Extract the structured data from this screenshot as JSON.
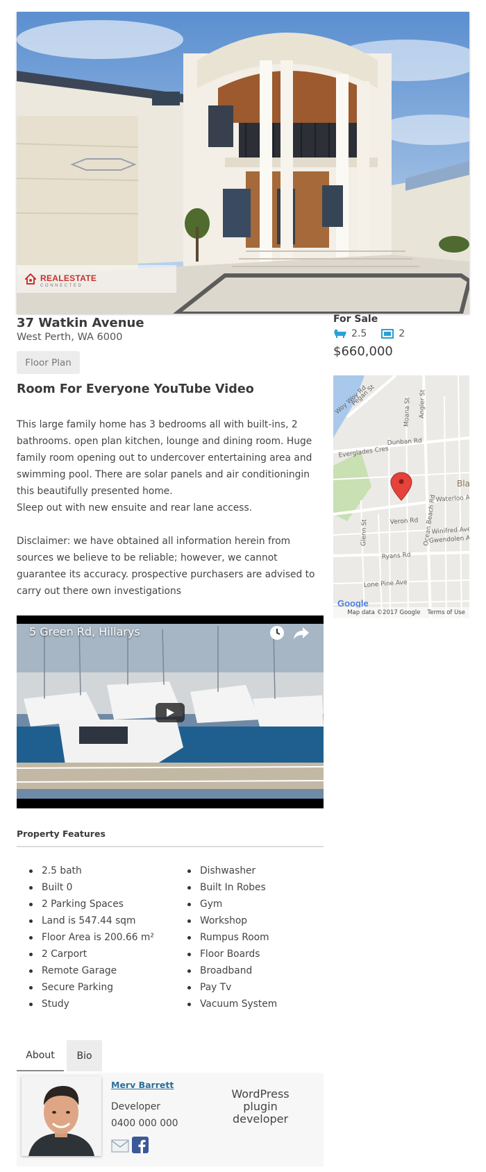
{
  "listing": {
    "title": "37 Watkin Avenue",
    "suburb": "West Perth, WA 6000",
    "status": "For Sale",
    "bathrooms": "2.5",
    "parking": "2",
    "price": "$660,000"
  },
  "logo": {
    "text": "REALESTATE",
    "sub": "CONNECTED",
    "colors": {
      "brand": "#c8312d"
    }
  },
  "buttons": {
    "floor_plan": "Floor Plan"
  },
  "video_section": {
    "heading": "Room For Everyone YouTube Video",
    "video_title": "5 Green Rd, Hillarys"
  },
  "description": {
    "p1": "This large family home has 3 bedrooms all with built-ins, 2 bathrooms. open plan kitchen, lounge and dining room. Huge family room opening out to undercover entertaining area and swimming pool. There are solar panels and air conditioningin this beautifully presented home.",
    "p2": "Sleep out with new ensuite and rear lane access.",
    "p3": "Disclaimer: we have obtained all information herein from sources we believe to be reliable; however, we cannot guarantee its accuracy. prospective purchasers are advised to carry out there own investigations"
  },
  "map": {
    "streets": [
      "Woy Woy Rd",
      "Pegan St",
      "Moana St",
      "Angler St",
      "Dunban Rd",
      "Everglades Cres",
      "Waterloo A",
      "Veron Rd",
      "Winifred Ave",
      "Gwendolen A",
      "Glenn St",
      "Ocean Beach Rd",
      "Ryans Rd",
      "Lone Pine Ave",
      "Bla"
    ],
    "footer_data": "Map data ©2017 Google",
    "footer_terms": "Terms of Use",
    "google_logo": "Google"
  },
  "features": {
    "heading": "Property Features",
    "left": [
      "2.5 bath",
      "Built 0",
      "2 Parking Spaces",
      "Land is 547.44 sqm",
      "Floor Area is 200.66 m²",
      "2 Carport",
      "Remote Garage",
      "Secure Parking",
      "Study"
    ],
    "right": [
      "Dishwasher",
      "Built In Robes",
      "Gym",
      "Workshop",
      "Rumpus Room",
      "Floor Boards",
      "Broadband",
      "Pay Tv",
      "Vacuum System"
    ]
  },
  "tabs": {
    "about": "About",
    "bio": "Bio"
  },
  "author": {
    "name": "Merv Barrett",
    "role": "Developer",
    "phone": "0400 000 000",
    "bio": "WordPress plugin developer"
  },
  "icons": {
    "bath": "bath-icon",
    "car": "car-icon",
    "clock": "clock-icon",
    "share": "share-icon",
    "play": "play-icon",
    "pin": "map-pin-icon",
    "email": "email-icon",
    "facebook": "facebook-icon"
  }
}
